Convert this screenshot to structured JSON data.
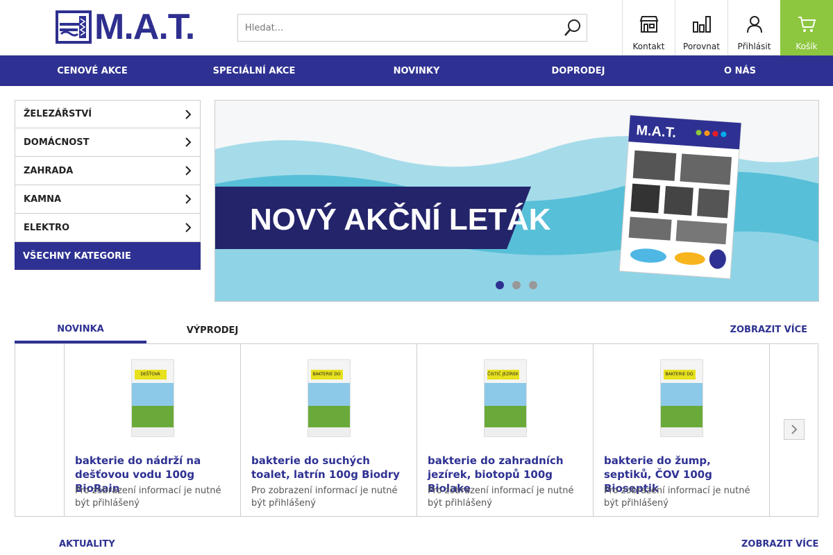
{
  "brand": {
    "name": "M.A.T.",
    "primary": "#2e3192",
    "accent": "#8dc63f"
  },
  "search": {
    "placeholder": "Hledat..."
  },
  "header_buttons": [
    {
      "label": "Kontakt",
      "icon": "store-icon"
    },
    {
      "label": "Porovnat",
      "icon": "compare-icon"
    },
    {
      "label": "Přihlásit",
      "icon": "user-icon"
    },
    {
      "label": "Košík",
      "icon": "cart-icon"
    }
  ],
  "nav": [
    "CENOVÉ AKCE",
    "SPECIÁLNÍ AKCE",
    "NOVINKY",
    "DOPRODEJ",
    "O NÁS"
  ],
  "categories": [
    "ŽELEZÁŘSTVÍ",
    "DOMÁCNOST",
    "ZAHRADA",
    "KAMNA",
    "ELEKTRO"
  ],
  "all_categories": "VŠECHNY KATEGORIE",
  "banner": {
    "headline": "NOVÝ AKČNÍ LETÁK",
    "leaflet_brand": "M.A.T.",
    "slides": 3,
    "active_slide": 1
  },
  "tabs": [
    "NOVINKA",
    "VÝPRODEJ"
  ],
  "active_tab": "NOVINKA",
  "show_more": "ZOBRAZIT VÍCE",
  "products": [
    {
      "title": "bakterie do nádrží na dešťovou vodu 100g BioRain",
      "note": "Pro zobrazení informací je nutné být přihlášený",
      "pack_label": "DEŠŤOVÁ VODA"
    },
    {
      "title": "bakterie do suchých toalet, latrín 100g Biodry",
      "note": "Pro zobrazení informací je nutné být přihlášený",
      "pack_label": "BAKTERIE DO SUCHÝCH WC"
    },
    {
      "title": "bakterie do zahradních jezírek, biotopů 100g Biolake",
      "note": "Pro zobrazení informací je nutné být přihlášený",
      "pack_label": "ČISTIČ JEZÍREK"
    },
    {
      "title": "bakterie do žump, septiků, ČOV 100g Bioseptik",
      "note": "Pro zobrazení informací je nutné být přihlášený",
      "pack_label": "BAKTERIE DO ŽUMP"
    }
  ],
  "news": {
    "title": "AKTUALITY",
    "more": "ZOBRAZIT VÍCE"
  }
}
